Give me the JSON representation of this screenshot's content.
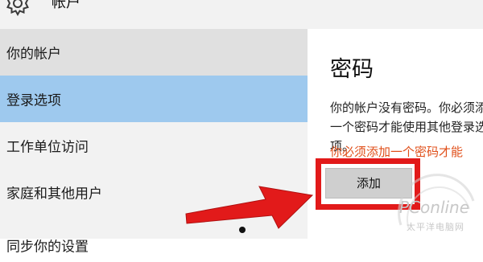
{
  "header": {
    "title": "帐户",
    "icon": "gear-icon"
  },
  "sidebar": {
    "items": [
      {
        "label": "你的帐户"
      },
      {
        "label": "登录选项",
        "selected": true
      },
      {
        "label": "工作单位访问"
      },
      {
        "label": "家庭和其他用户"
      },
      {
        "label": "同步你的设置"
      }
    ]
  },
  "content": {
    "heading": "密码",
    "description": "你的帐户没有密码。你必须添加一个密码才能使用其他登录选项。",
    "warning": "你必须添加一个密码才能",
    "add_button": "添加"
  },
  "watermark": {
    "brand": "PConline",
    "sub": "太平洋电脑网"
  },
  "colors": {
    "selected_nav": "#9ec9ee",
    "hover_nav": "#e0e0e0",
    "sidebar_bg": "#f2f2f2",
    "warning_text": "#e0501b",
    "annotation_red": "#e21a1a"
  }
}
